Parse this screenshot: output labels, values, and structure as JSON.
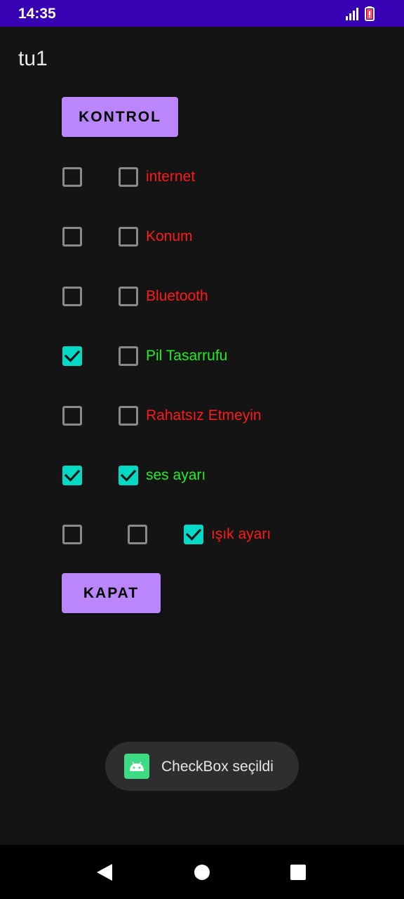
{
  "status_bar": {
    "time": "14:35",
    "signal_icon": "signal-icon",
    "battery_icon": "battery-icon"
  },
  "app": {
    "title": "tu1"
  },
  "buttons": {
    "kontrol": "KONTROL",
    "kapat": "KAPAT"
  },
  "rows": [
    {
      "label": "internet",
      "label_color": "#ff1a1a",
      "checks": [
        false,
        false
      ]
    },
    {
      "label": "Konum",
      "label_color": "#ff1a1a",
      "checks": [
        false,
        false
      ]
    },
    {
      "label": "Bluetooth",
      "label_color": "#ff1a1a",
      "checks": [
        false,
        false
      ]
    },
    {
      "label": "Pil Tasarrufu",
      "label_color": "#22ee22",
      "checks": [
        true,
        false
      ]
    },
    {
      "label": "Rahatsız Etmeyin",
      "label_color": "#ff1a1a",
      "checks": [
        false,
        false
      ]
    },
    {
      "label": "ses ayarı",
      "label_color": "#22ee22",
      "checks": [
        true,
        true
      ]
    },
    {
      "label": "ışık ayarı",
      "label_color": "#ff1a1a",
      "checks": [
        false,
        false,
        true
      ]
    }
  ],
  "toast": {
    "text": "CheckBox seçildi",
    "icon": "android-icon"
  },
  "nav": {
    "back_icon": "back-icon",
    "home_icon": "home-icon",
    "recents_icon": "recents-icon"
  },
  "colors": {
    "status_bar": "#3700b3",
    "accent": "#bb86fc",
    "checkbox_checked": "#03dac5",
    "background": "#141414"
  }
}
